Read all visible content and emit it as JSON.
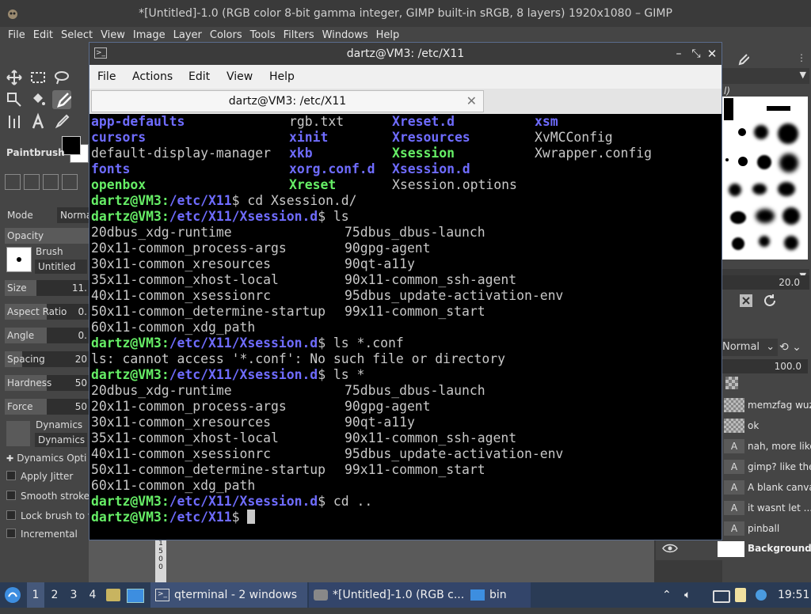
{
  "gimp": {
    "title": "*[Untitled]-1.0 (RGB color 8-bit gamma integer, GIMP built-in sRGB, 8 layers) 1920x1080 – GIMP",
    "menu": [
      "File",
      "Edit",
      "Select",
      "View",
      "Image",
      "Layer",
      "Colors",
      "Tools",
      "Filters",
      "Windows",
      "Help"
    ],
    "tool_options": {
      "title": "Paintbrush",
      "mode_label": "Mode",
      "mode_value": "Normal",
      "opacity_label": "Opacity",
      "brush_label": "Brush",
      "brush_value": "Untitled",
      "size_label": "Size",
      "size_value": "11.",
      "aspect_label": "Aspect Ratio",
      "aspect_value": "0.",
      "angle_label": "Angle",
      "angle_value": "0.",
      "spacing_label": "Spacing",
      "spacing_value": "20",
      "hardness_label": "Hardness",
      "hardness_value": "50",
      "force_label": "Force",
      "force_value": "50",
      "dynamics_label": "Dynamics",
      "dynamics_value": "Dynamics",
      "dynamics_options": "Dynamics Opti",
      "apply_jitter": "Apply Jitter",
      "smooth_stroke": "Smooth stroke",
      "lock_brush": "Lock brush to v",
      "incremental": "Incremental"
    },
    "dock": {
      "brush_label": "l)",
      "spacing_value": "20.0",
      "mode_value": "Normal",
      "opacity_value": "100.0",
      "layers": [
        {
          "name": "memzfag wuz",
          "type": "image"
        },
        {
          "name": "ok",
          "type": "image"
        },
        {
          "name": "nah, more like",
          "type": "text"
        },
        {
          "name": "gimp? like the",
          "type": "text"
        },
        {
          "name": "A blank canva",
          "type": "text"
        },
        {
          "name": "it wasnt let ...",
          "type": "text"
        },
        {
          "name": "pinball",
          "type": "text"
        }
      ],
      "background_layer": "Background"
    },
    "ruler": [
      "1",
      "5",
      "0",
      "0"
    ]
  },
  "terminal": {
    "window_title": "dartz@VM3: /etc/X11",
    "menu": [
      "File",
      "Actions",
      "Edit",
      "View",
      "Help"
    ],
    "tab_label": "dartz@VM3: /etc/X11",
    "prompt_user": "dartz@VM3",
    "lines": [
      {
        "type": "cols4",
        "cells": [
          {
            "t": "app-defaults",
            "k": "dir"
          },
          {
            "t": "rgb.txt",
            "k": "file"
          },
          {
            "t": "Xreset.d",
            "k": "dir"
          },
          {
            "t": "xsm",
            "k": "dir"
          }
        ]
      },
      {
        "type": "cols4",
        "cells": [
          {
            "t": "cursors",
            "k": "dir"
          },
          {
            "t": "xinit",
            "k": "dir"
          },
          {
            "t": "Xresources",
            "k": "dir"
          },
          {
            "t": "XvMCConfig",
            "k": "file"
          }
        ]
      },
      {
        "type": "cols4",
        "cells": [
          {
            "t": "default-display-manager",
            "k": "file"
          },
          {
            "t": "xkb",
            "k": "dir"
          },
          {
            "t": "Xsession",
            "k": "exe"
          },
          {
            "t": "Xwrapper.config",
            "k": "file"
          }
        ]
      },
      {
        "type": "cols4",
        "cells": [
          {
            "t": "fonts",
            "k": "dir"
          },
          {
            "t": "xorg.conf.d",
            "k": "dir"
          },
          {
            "t": "Xsession.d",
            "k": "dir"
          },
          {
            "t": "",
            "k": "file"
          }
        ]
      },
      {
        "type": "cols4",
        "cells": [
          {
            "t": "openbox",
            "k": "exe"
          },
          {
            "t": "Xreset",
            "k": "exe"
          },
          {
            "t": "Xsession.options",
            "k": "file"
          },
          {
            "t": "",
            "k": "file"
          }
        ]
      },
      {
        "type": "prompt",
        "path": "/etc/X11",
        "cmd": " cd Xsession.d/"
      },
      {
        "type": "prompt",
        "path": "/etc/X11/Xsession.d",
        "cmd": " ls"
      },
      {
        "type": "cols2",
        "a": "20dbus_xdg-runtime",
        "b": "75dbus_dbus-launch"
      },
      {
        "type": "cols2",
        "a": "20x11-common_process-args",
        "b": "90gpg-agent"
      },
      {
        "type": "cols2",
        "a": "30x11-common_xresources",
        "b": "90qt-a11y"
      },
      {
        "type": "cols2",
        "a": "35x11-common_xhost-local",
        "b": "90x11-common_ssh-agent"
      },
      {
        "type": "cols2",
        "a": "40x11-common_xsessionrc",
        "b": "95dbus_update-activation-env"
      },
      {
        "type": "cols2",
        "a": "50x11-common_determine-startup",
        "b": "99x11-common_start"
      },
      {
        "type": "cols2",
        "a": "60x11-common_xdg_path",
        "b": ""
      },
      {
        "type": "prompt",
        "path": "/etc/X11/Xsession.d",
        "cmd": " ls *.conf"
      },
      {
        "type": "plain",
        "text": "ls: cannot access '*.conf': No such file or directory"
      },
      {
        "type": "prompt",
        "path": "/etc/X11/Xsession.d",
        "cmd": " ls *"
      },
      {
        "type": "cols2",
        "a": "20dbus_xdg-runtime",
        "b": "75dbus_dbus-launch"
      },
      {
        "type": "cols2",
        "a": "20x11-common_process-args",
        "b": "90gpg-agent"
      },
      {
        "type": "cols2",
        "a": "30x11-common_xresources",
        "b": "90qt-a11y"
      },
      {
        "type": "cols2",
        "a": "35x11-common_xhost-local",
        "b": "90x11-common_ssh-agent"
      },
      {
        "type": "cols2",
        "a": "40x11-common_xsessionrc",
        "b": "95dbus_update-activation-env"
      },
      {
        "type": "cols2",
        "a": "50x11-common_determine-startup",
        "b": "99x11-common_start"
      },
      {
        "type": "cols2",
        "a": "60x11-common_xdg_path",
        "b": ""
      },
      {
        "type": "prompt",
        "path": "/etc/X11/Xsession.d",
        "cmd": " cd .."
      },
      {
        "type": "prompt",
        "path": "/etc/X11",
        "cmd": " ",
        "cursor": true
      }
    ],
    "colors": {
      "dir": "#6f6cff",
      "exe": "#66ee66",
      "prompt": "#66ee66",
      "text": "#c8c8c8"
    }
  },
  "taskbar": {
    "workspaces": [
      "1",
      "2",
      "3",
      "4"
    ],
    "current_workspace": "1",
    "tasks": [
      "qterminal - 2 windows",
      "*[Untitled]-1.0 (RGB c...",
      "bin"
    ],
    "clock": "19:51"
  }
}
